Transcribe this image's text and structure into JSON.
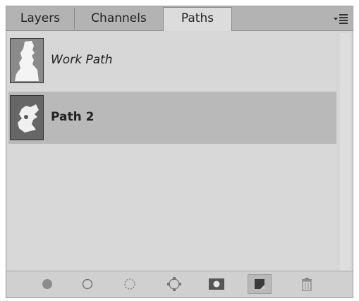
{
  "tabs": [
    {
      "label": "Layers",
      "active": false
    },
    {
      "label": "Channels",
      "active": false
    },
    {
      "label": "Paths",
      "active": true
    }
  ],
  "panel_menu_icon": "panel-menu-icon",
  "paths": [
    {
      "name": "Work Path",
      "selected": false,
      "style": "italic"
    },
    {
      "name": "Path 2",
      "selected": true,
      "style": "bold"
    }
  ],
  "footer_buttons": [
    {
      "icon": "fill-path-icon"
    },
    {
      "icon": "stroke-path-icon"
    },
    {
      "icon": "load-path-as-selection-icon"
    },
    {
      "icon": "make-work-path-icon"
    },
    {
      "icon": "add-mask-icon"
    },
    {
      "icon": "create-new-path-icon"
    },
    {
      "icon": "delete-path-icon"
    }
  ]
}
